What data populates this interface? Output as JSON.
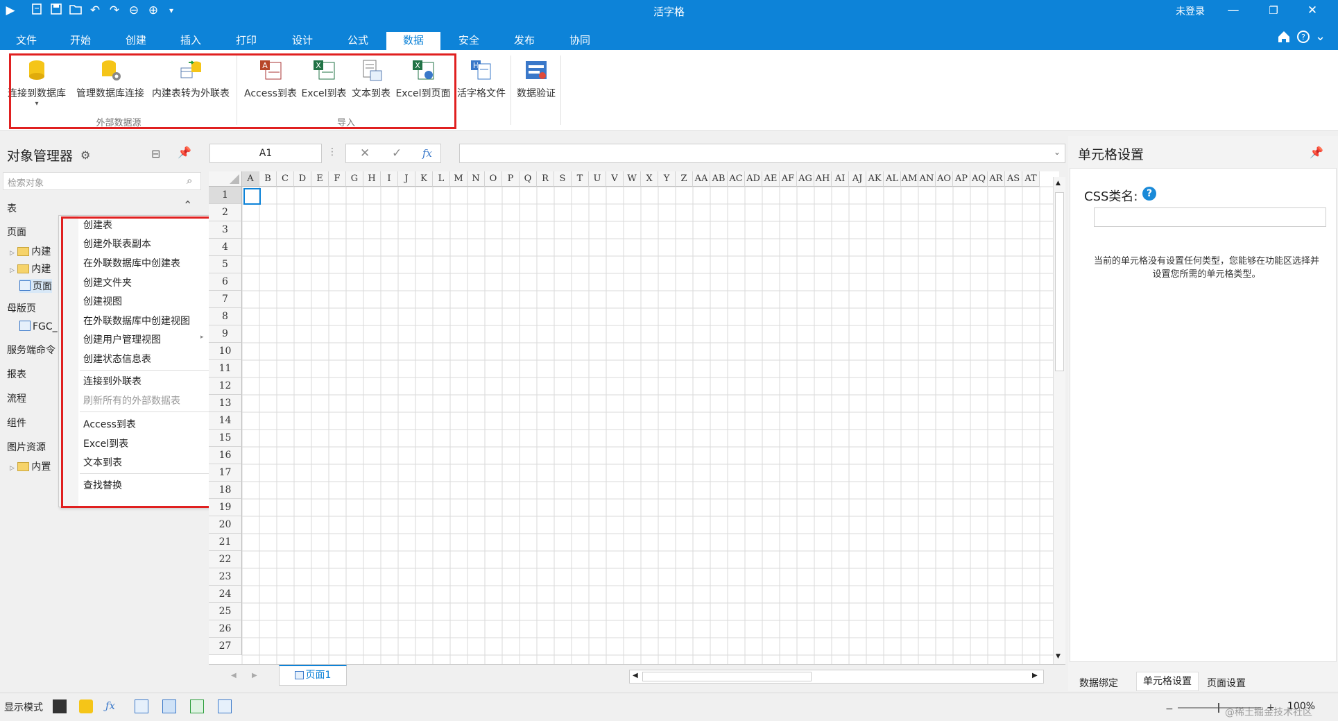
{
  "window": {
    "title": "活字格",
    "login_status": "未登录"
  },
  "quick_access": [
    "run-icon",
    "new-icon",
    "save-icon",
    "open-icon",
    "undo-icon",
    "redo-icon",
    "back-icon",
    "forward-icon",
    "customize-icon"
  ],
  "menu_tabs": [
    "文件",
    "开始",
    "创建",
    "插入",
    "打印",
    "设计",
    "公式",
    "数据",
    "安全",
    "发布",
    "协同"
  ],
  "active_tab": "数据",
  "ribbon": {
    "external": {
      "label": "外部数据源",
      "buttons": [
        "连接到数据库",
        "管理数据库连接",
        "内建表转为外联表"
      ]
    },
    "import": {
      "label": "导入",
      "buttons": [
        "Access到表",
        "Excel到表",
        "文本到表",
        "Excel到页面"
      ]
    },
    "other": [
      "活字格文件",
      "数据验证"
    ]
  },
  "object_manager": {
    "title": "对象管理器",
    "search_placeholder": "检索对象",
    "sections": {
      "table": "表",
      "page": "页面",
      "master": "母版页",
      "server": "服务端命令",
      "report": "报表",
      "flow": "流程",
      "component": "组件",
      "image": "图片资源"
    },
    "tree": {
      "builtin1": "内建",
      "builtin2": "内建",
      "page": "页面",
      "fgc": "FGC_",
      "builtin_img": "内置"
    }
  },
  "context_menu": {
    "items": [
      "创建表",
      "创建外联表副本",
      "在外联数据库中创建表",
      "创建文件夹",
      "创建视图",
      "在外联数据库中创建视图",
      "创建用户管理视图",
      "创建状态信息表",
      "连接到外联表",
      "刷新所有的外部数据表",
      "Access到表",
      "Excel到表",
      "文本到表",
      "查找替换"
    ]
  },
  "formula_bar": {
    "cell_ref": "A1",
    "fx": "fx"
  },
  "grid": {
    "columns": [
      "A",
      "B",
      "C",
      "D",
      "E",
      "F",
      "G",
      "H",
      "I",
      "J",
      "K",
      "L",
      "M",
      "N",
      "O",
      "P",
      "Q",
      "R",
      "S",
      "T",
      "U",
      "V",
      "W",
      "X",
      "Y",
      "Z",
      "AA",
      "AB",
      "AC",
      "AD",
      "AE",
      "AF",
      "AG",
      "AH",
      "AI",
      "AJ",
      "AK",
      "AL",
      "AM",
      "AN",
      "AO",
      "AP",
      "AQ",
      "AR",
      "AS",
      "AT"
    ],
    "rows": [
      "1",
      "2",
      "3",
      "4",
      "5",
      "6",
      "7",
      "8",
      "9",
      "10",
      "11",
      "12",
      "13",
      "14",
      "15",
      "16",
      "17",
      "18",
      "19",
      "20",
      "21",
      "22",
      "23",
      "24",
      "25",
      "26",
      "27"
    ],
    "sheet_tab": "页面1"
  },
  "cell_settings": {
    "title": "单元格设置",
    "css_label": "CSS类名:",
    "css_value": "",
    "hint": "当前的单元格没有设置任何类型，您能够在功能区选择并设置您所需的单元格类型。",
    "tabs": [
      "数据绑定",
      "单元格设置",
      "页面设置"
    ]
  },
  "status_bar": {
    "display_mode": "显示模式",
    "zoom": "100%",
    "watermark": "@稀土掘金技术社区"
  },
  "colors": {
    "accent": "#0d83d8",
    "highlight": "#e02020",
    "context_bg": "#ffffff"
  }
}
